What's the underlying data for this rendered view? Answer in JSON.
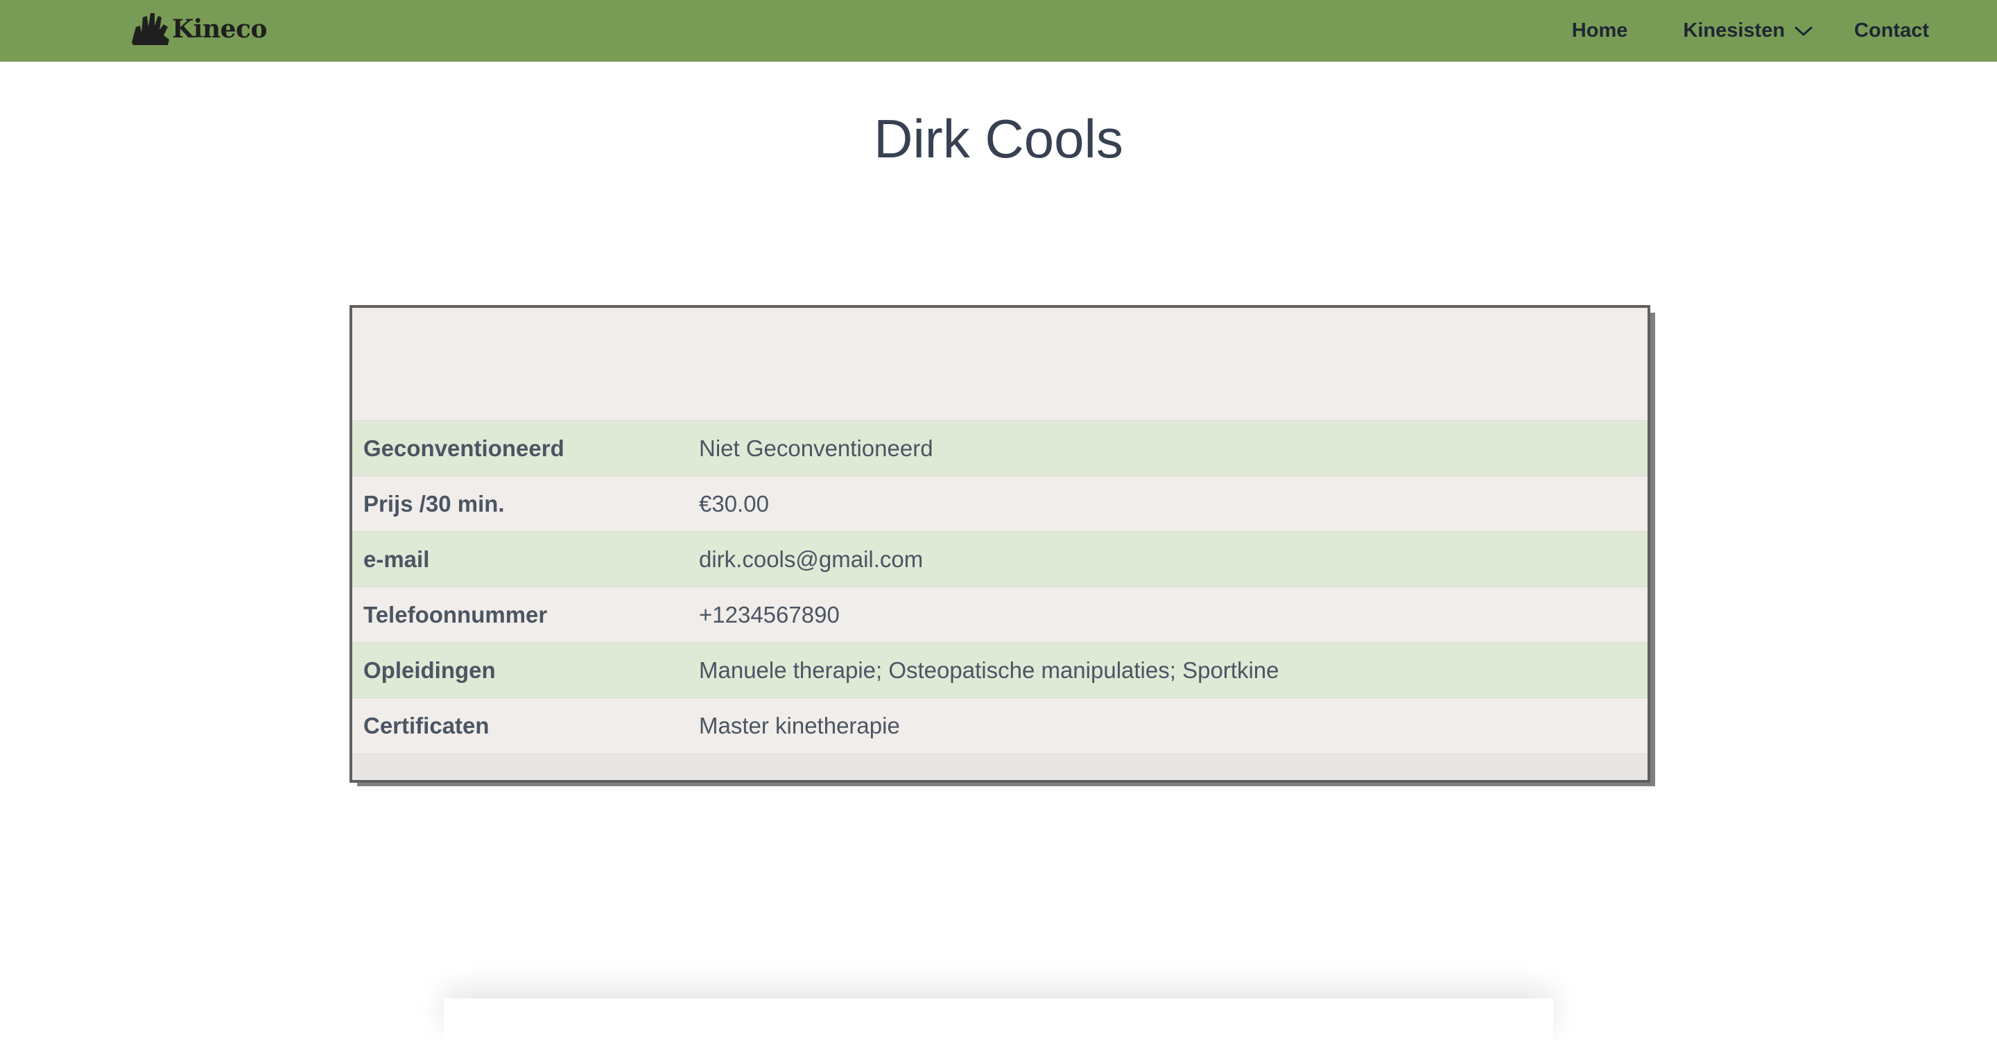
{
  "brand": {
    "logo_icon": "hand-icon",
    "name": "Kineco",
    "nav_color": "#789c55"
  },
  "nav": {
    "home_label": "Home",
    "kinesisten_label": "Kinesisten",
    "kinesisten_icon": "chevron-down-icon",
    "contact_label": "Contact"
  },
  "page": {
    "title": "Dirk Cools"
  },
  "details": {
    "rows": [
      {
        "label": "Geconventioneerd",
        "value": "Niet Geconventioneerd"
      },
      {
        "label": "Prijs /30 min.",
        "value": "€30.00"
      },
      {
        "label": "e-mail",
        "value": "dirk.cools@gmail.com"
      },
      {
        "label": "Telefoonnummer",
        "value": "+1234567890"
      },
      {
        "label": "Opleidingen",
        "value": "Manuele therapie; Osteopatische manipulaties; Sportkine"
      },
      {
        "label": "Certificaten",
        "value": "Master kinetherapie"
      }
    ]
  }
}
